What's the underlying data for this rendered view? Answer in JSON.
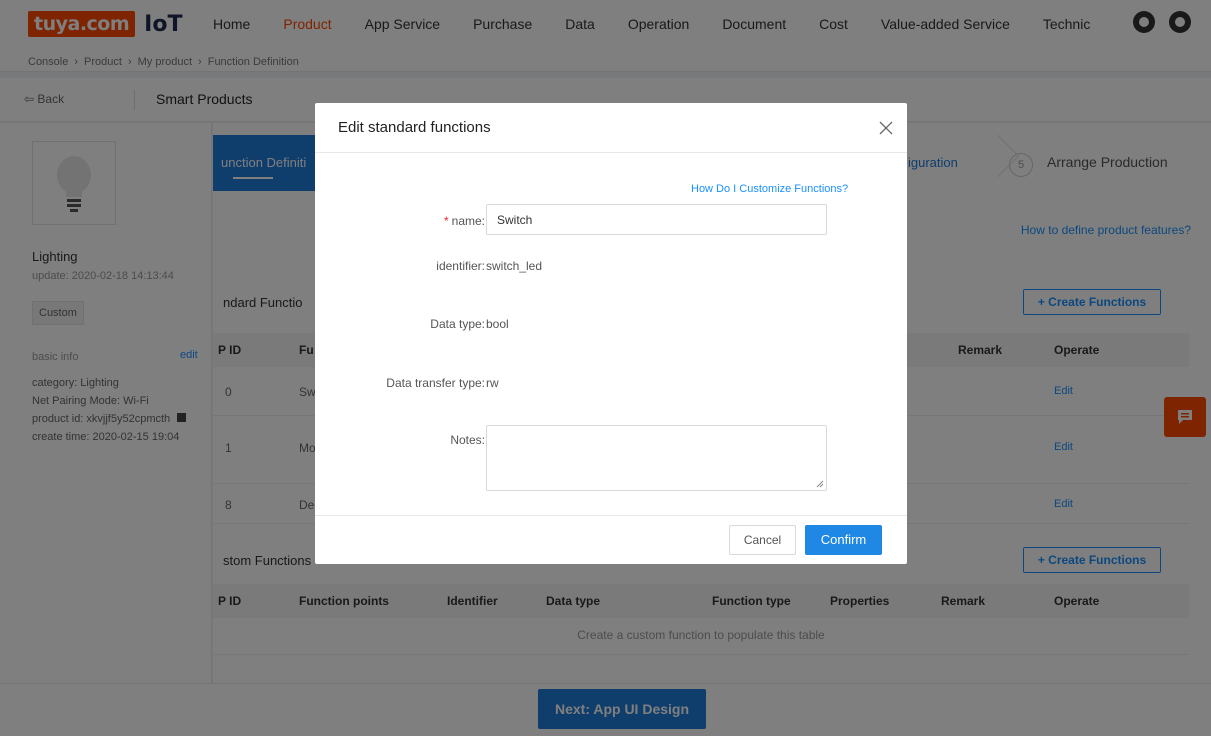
{
  "header": {
    "logo_text": "tuya.com",
    "logo_suffix": "IoT",
    "nav": [
      "Home",
      "Product",
      "App Service",
      "Purchase",
      "Data",
      "Operation",
      "Document",
      "Cost",
      "Value-added Service",
      "Technic"
    ],
    "active_nav": "Product",
    "breadcrumb": [
      "Console",
      "›",
      "Product",
      "›",
      "My product",
      "›",
      "Function Definition"
    ]
  },
  "subheader": {
    "back_label": "Back",
    "title": "Smart Products"
  },
  "sidebar": {
    "product_name": "Lighting",
    "update": "update: 2020-02-18 14:13:44",
    "tag": "Custom",
    "basic_info_label": "basic info",
    "edit_label": "edit",
    "category": "category: Lighting",
    "net_pairing": "Net Pairing Mode: Wi-Fi",
    "product_id": "product id: xkvjjf5y52cpmcth",
    "create_time": "create time: 2020-02-15 19:04"
  },
  "steps": {
    "active": "unction Definiti",
    "configuration": "iguration",
    "arrange_num": "5",
    "arrange": "Arrange Production"
  },
  "main": {
    "how_define_link": "How to define product features?",
    "standard_title": "ndard Functio",
    "create_functions": "+ Create Functions",
    "std_headers": {
      "dp_id": "P ID",
      "func": "Fu",
      "remark": "Remark",
      "operate": "Operate"
    },
    "std_rows": [
      {
        "dp": "0",
        "name": "Sw",
        "edit": "Edit"
      },
      {
        "dp": "1",
        "name": "Mo",
        "edit": "Edit"
      },
      {
        "dp": "8",
        "name": "De",
        "edit": "Edit"
      }
    ],
    "custom_title": "stom Functions",
    "custom_headers": {
      "dp_id": "P ID",
      "function_points": "Function points",
      "identifier": "Identifier",
      "data_type": "Data type",
      "function_type": "Function type",
      "properties": "Properties",
      "remark": "Remark",
      "operate": "Operate"
    },
    "empty_message": "Create a custom function to populate this table"
  },
  "footer": {
    "next_label": "Next:  App UI Design"
  },
  "modal": {
    "title": "Edit standard functions",
    "help_link": "How Do I Customize Functions?",
    "name_label": "name:",
    "name_value": "Switch",
    "identifier_label": "identifier:",
    "identifier_value": "switch_led",
    "data_type_label": "Data type:",
    "data_type_value": "bool",
    "transfer_label": "Data transfer type:",
    "transfer_value": "rw",
    "notes_label": "Notes:",
    "cancel_label": "Cancel",
    "confirm_label": "Confirm"
  }
}
